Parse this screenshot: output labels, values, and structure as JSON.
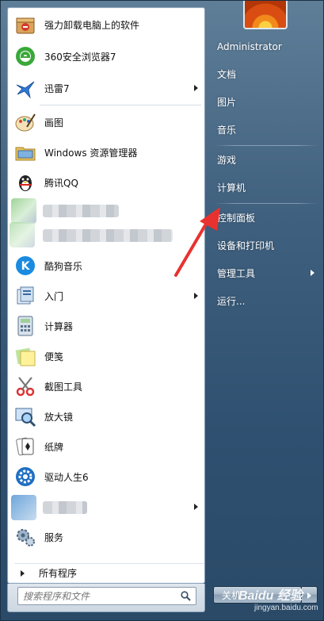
{
  "programs": [
    {
      "label": "强力卸载电脑上的软件",
      "icon": "uninstall-box-icon"
    },
    {
      "label": "360安全浏览器7",
      "icon": "browser-360-icon"
    },
    {
      "label": "迅雷7",
      "icon": "thunder-bird-icon",
      "has_submenu": true
    },
    {
      "label": "画图",
      "icon": "paint-palette-icon"
    },
    {
      "label": "Windows 资源管理器",
      "icon": "explorer-folder-icon"
    },
    {
      "label": "腾讯QQ",
      "icon": "qq-penguin-icon"
    },
    {
      "label": "酷狗音乐",
      "icon": "kugou-k-icon"
    },
    {
      "label": "入门",
      "icon": "getting-started-icon",
      "has_submenu": true
    },
    {
      "label": "计算器",
      "icon": "calculator-icon"
    },
    {
      "label": "便笺",
      "icon": "sticky-notes-icon"
    },
    {
      "label": "截图工具",
      "icon": "snipping-tool-icon"
    },
    {
      "label": "放大镜",
      "icon": "magnifier-icon"
    },
    {
      "label": "纸牌",
      "icon": "solitaire-icon"
    },
    {
      "label": "驱动人生6",
      "icon": "driver-gear-icon"
    },
    {
      "label": "服务",
      "icon": "services-gears-icon"
    }
  ],
  "all_programs_label": "所有程序",
  "search": {
    "placeholder": "搜索程序和文件"
  },
  "right_items": [
    {
      "label": "Administrator"
    },
    {
      "label": "文档"
    },
    {
      "label": "图片"
    },
    {
      "label": "音乐"
    },
    {
      "label": "游戏"
    },
    {
      "label": "计算机"
    },
    {
      "label": "控制面板"
    },
    {
      "label": "设备和打印机"
    },
    {
      "label": "管理工具",
      "has_submenu": true
    },
    {
      "label": "运行..."
    }
  ],
  "shutdown_label": "关机",
  "watermark": {
    "text": "Baidu 经验",
    "sub": "jingyan.baidu.com"
  },
  "colors": {
    "annotation": "#e8322f",
    "frame": "#3f607e"
  }
}
